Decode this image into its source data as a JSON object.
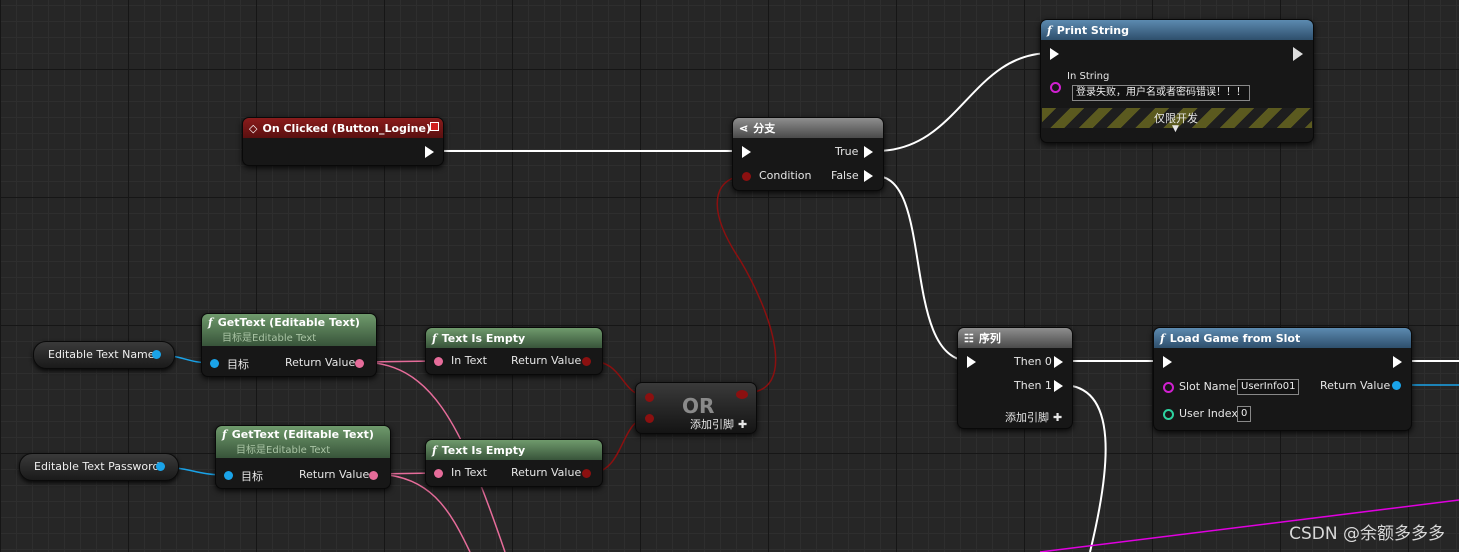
{
  "colors": {
    "exec_wire": "#ffffff",
    "bool_wire": "#8b1010",
    "text_wire": "#e66c9a",
    "object_wire": "#1aa3e8",
    "string_wire": "#e000e0"
  },
  "nodes": {
    "on_clicked": {
      "title": "On Clicked (Button_Logine)",
      "icon": "event-diamond-icon"
    },
    "branch": {
      "title": "分支",
      "condition": "Condition",
      "true": "True",
      "false": "False"
    },
    "print_string": {
      "title": "Print String",
      "in_string_label": "In String",
      "in_string_value": "登录失败，用户名或者密码错误！！！",
      "dev_only": "仅限开发"
    },
    "get_text_1": {
      "title": "GetText (Editable Text)",
      "subtitle": "目标是Editable Text",
      "target": "目标",
      "return": "Return Value"
    },
    "get_text_2": {
      "title": "GetText (Editable Text)",
      "subtitle": "目标是Editable Text",
      "target": "目标",
      "return": "Return Value"
    },
    "text_empty_1": {
      "title": "Text Is Empty",
      "in": "In Text",
      "return": "Return Value"
    },
    "text_empty_2": {
      "title": "Text Is Empty",
      "in": "In Text",
      "return": "Return Value"
    },
    "or": {
      "title": "OR",
      "add_pin": "添加引脚"
    },
    "sequence": {
      "title": "序列",
      "then0": "Then 0",
      "then1": "Then 1",
      "add_pin": "添加引脚"
    },
    "load_game": {
      "title": "Load Game from Slot",
      "slot_name_label": "Slot Name",
      "slot_name_value": "UserInfo01",
      "user_index_label": "User Index",
      "user_index_value": "0",
      "return": "Return Value"
    }
  },
  "variables": {
    "name": "Editable Text Name",
    "password": "Editable Text Password"
  },
  "watermark": "CSDN @余额多多多"
}
